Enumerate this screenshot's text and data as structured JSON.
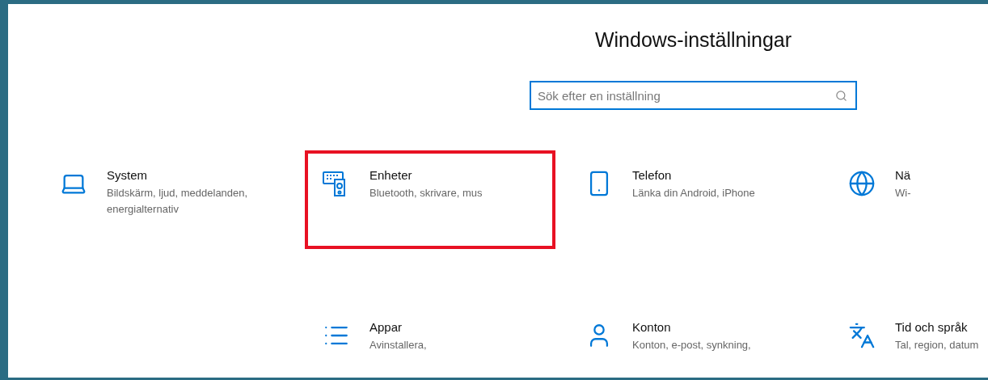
{
  "window": {
    "title": "Windows-inställningar"
  },
  "search": {
    "placeholder": "Sök efter en inställning"
  },
  "rows": [
    [
      {
        "kind": "laptop",
        "title": "System",
        "description": "Bildskärm, ljud, meddelanden, energialternativ",
        "highlighted": false
      },
      {
        "kind": "devices",
        "title": "Enheter",
        "description": "Bluetooth, skrivare, mus",
        "highlighted": true
      },
      {
        "kind": "phone",
        "title": "Telefon",
        "description": "Länka din Android, iPhone",
        "highlighted": false
      },
      {
        "kind": "globe",
        "title": "Nä",
        "description": "Wi-",
        "highlighted": false
      }
    ],
    [
      {
        "kind": "list",
        "title": "Appar",
        "description": "Avinstallera,",
        "highlighted": false
      },
      {
        "kind": "person",
        "title": "Konton",
        "description": "Konton, e-post, synkning,",
        "highlighted": false
      },
      {
        "kind": "language",
        "title": "Tid och språk",
        "description": "Tal, region, datum",
        "highlighted": false
      }
    ]
  ]
}
